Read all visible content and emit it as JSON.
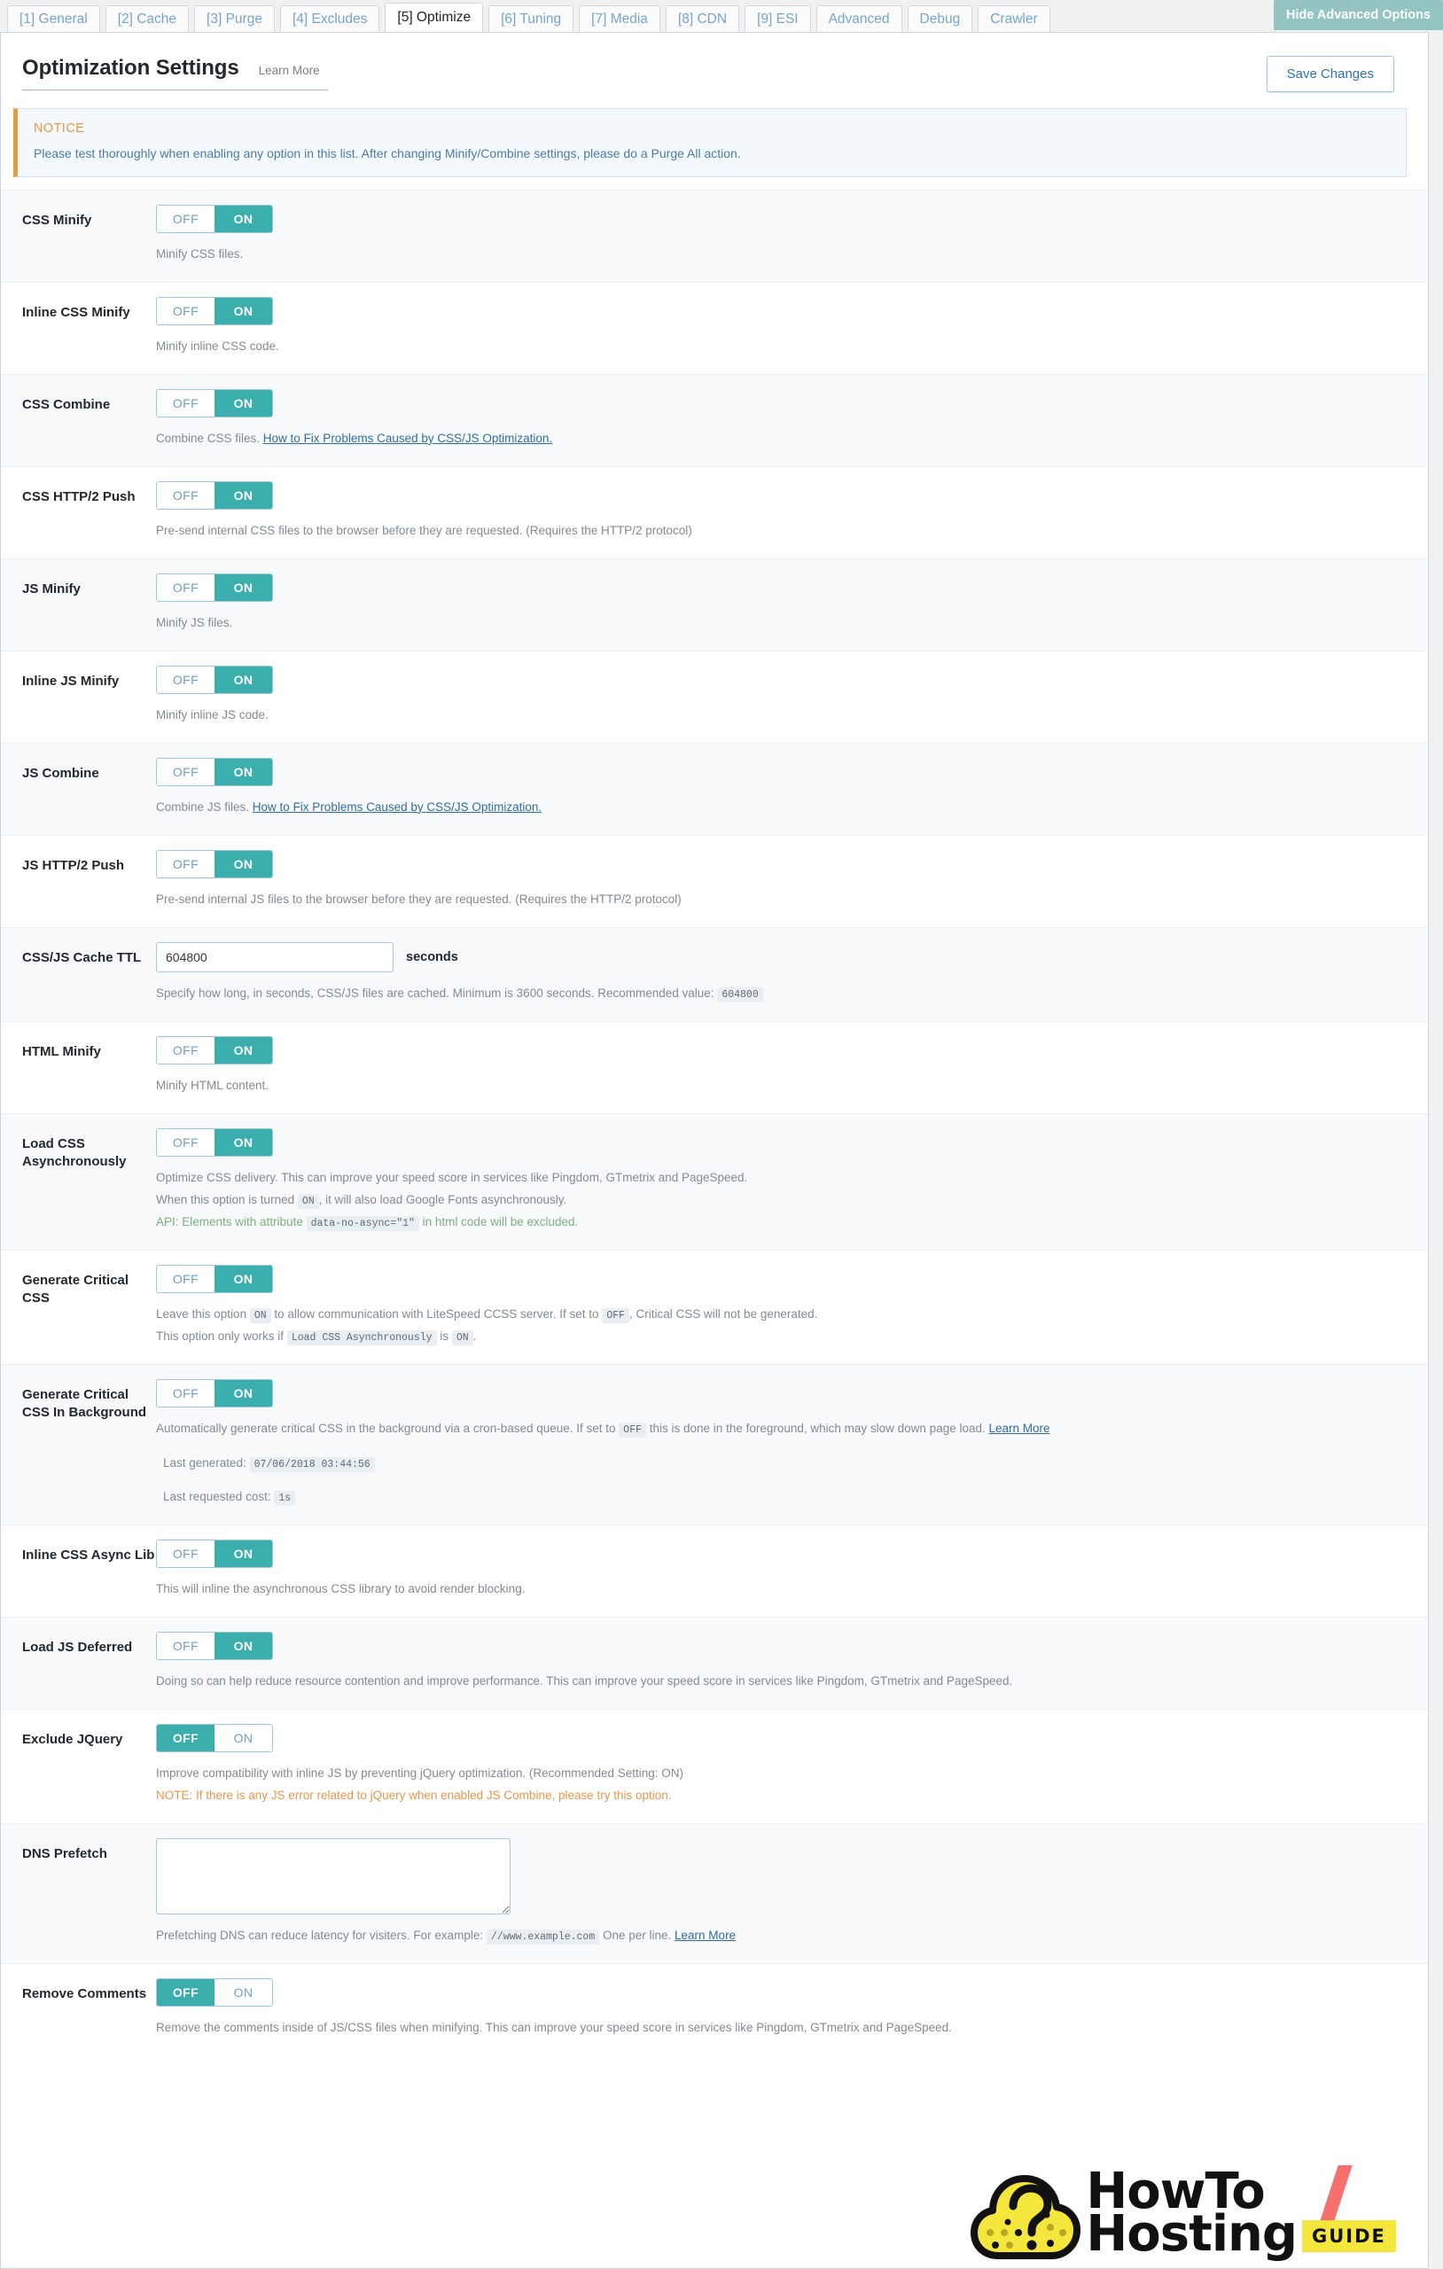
{
  "tabs": [
    {
      "label": "[1] General",
      "active": false
    },
    {
      "label": "[2] Cache",
      "active": false
    },
    {
      "label": "[3] Purge",
      "active": false
    },
    {
      "label": "[4] Excludes",
      "active": false
    },
    {
      "label": "[5] Optimize",
      "active": true
    },
    {
      "label": "[6] Tuning",
      "active": false
    },
    {
      "label": "[7] Media",
      "active": false
    },
    {
      "label": "[8] CDN",
      "active": false
    },
    {
      "label": "[9] ESI",
      "active": false
    },
    {
      "label": "Advanced",
      "active": false
    },
    {
      "label": "Debug",
      "active": false
    },
    {
      "label": "Crawler",
      "active": false
    }
  ],
  "header": {
    "hide_advanced_label": "Hide Advanced Options",
    "title": "Optimization Settings",
    "learn_more": "Learn More",
    "save_label": "Save Changes"
  },
  "notice": {
    "title": "NOTICE",
    "text": "Please test thoroughly when enabling any option in this list. After changing Minify/Combine settings, please do a Purge All action."
  },
  "toggle": {
    "off": "OFF",
    "on": "ON"
  },
  "units": {
    "seconds": "seconds"
  },
  "colors": {
    "accent_on": "#3aafad",
    "tab_text": "#75a5cc",
    "notice_bar": "#e89b3c",
    "link": "#2e6da4",
    "logo_yellow": "#f5e63c",
    "logo_red": "#f8706e"
  },
  "settings": [
    {
      "label": "CSS Minify",
      "value": "ON",
      "desc_plain": "Minify CSS files."
    },
    {
      "label": "Inline CSS Minify",
      "value": "ON",
      "desc_plain": "Minify inline CSS code."
    },
    {
      "label": "CSS Combine",
      "value": "ON",
      "desc_plain": "Combine CSS files.",
      "desc_link": "How to Fix Problems Caused by CSS/JS Optimization."
    },
    {
      "label": "CSS HTTP/2 Push",
      "value": "ON",
      "desc_plain": "Pre-send internal CSS files to the browser before they are requested. (Requires the HTTP/2 protocol)"
    },
    {
      "label": "JS Minify",
      "value": "ON",
      "desc_plain": "Minify JS files."
    },
    {
      "label": "Inline JS Minify",
      "value": "ON",
      "desc_plain": "Minify inline JS code."
    },
    {
      "label": "JS Combine",
      "value": "ON",
      "desc_plain": "Combine JS files.",
      "desc_link": "How to Fix Problems Caused by CSS/JS Optimization."
    },
    {
      "label": "JS HTTP/2 Push",
      "value": "ON",
      "desc_plain": "Pre-send internal JS files to the browser before they are requested. (Requires the HTTP/2 protocol)"
    },
    {
      "label": "CSS/JS Cache TTL",
      "input_value": "604800",
      "unit": "seconds",
      "desc_plain": "Specify how long, in seconds, CSS/JS files are cached. Minimum is 3600 seconds. Recommended value:",
      "desc_code": "604800"
    },
    {
      "label": "HTML Minify",
      "value": "ON",
      "desc_plain": "Minify HTML content."
    },
    {
      "label": "Load CSS Asynchronously",
      "value": "ON",
      "desc_line1": "Optimize CSS delivery. This can improve your speed score in services like Pingdom, GTmetrix and PageSpeed.",
      "desc_line2_a": "When this option is turned",
      "desc_line2_code": "ON",
      "desc_line2_b": ", it will also load Google Fonts asynchronously.",
      "desc_line3_a": "API: Elements with attribute",
      "desc_line3_code": "data-no-async=\"1\"",
      "desc_line3_b": "in html code will be excluded."
    },
    {
      "label": "Generate Critical CSS",
      "value": "ON",
      "desc_line1_a": "Leave this option",
      "desc_line1_code1": "ON",
      "desc_line1_b": "to allow communication with LiteSpeed CCSS server. If set to",
      "desc_line1_code2": "OFF",
      "desc_line1_c": ", Critical CSS will not be generated.",
      "desc_line2_a": "This option only works if",
      "desc_line2_code1": "Load CSS Asynchronously",
      "desc_line2_b": "is",
      "desc_line2_code2": "ON",
      "desc_line2_c": "."
    },
    {
      "label": "Generate Critical CSS In Background",
      "value": "ON",
      "desc_line1_a": "Automatically generate critical CSS in the background via a cron-based queue. If set to",
      "desc_line1_code": "OFF",
      "desc_line1_b": "this is done in the foreground, which may slow down page load.",
      "desc_link": "Learn More",
      "last_generated_label": "Last generated:",
      "last_generated_value": "07/06/2018 03:44:56",
      "last_cost_label": "Last requested cost:",
      "last_cost_value": "1s"
    },
    {
      "label": "Inline CSS Async Lib",
      "value": "ON",
      "desc_plain": "This will inline the asynchronous CSS library to avoid render blocking."
    },
    {
      "label": "Load JS Deferred",
      "value": "ON",
      "desc_plain": "Doing so can help reduce resource contention and improve performance. This can improve your speed score in services like Pingdom, GTmetrix and PageSpeed."
    },
    {
      "label": "Exclude JQuery",
      "value": "OFF",
      "desc_plain": "Improve compatibility with inline JS by preventing jQuery optimization. (Recommended Setting: ON)",
      "desc_note": "NOTE: If there is any JS error related to jQuery when enabled JS Combine, please try this option."
    },
    {
      "label": "DNS Prefetch",
      "textarea_value": "",
      "desc_plain": "Prefetching DNS can reduce latency for visiters. For example:",
      "desc_code": "//www.example.com",
      "desc_plain2": "One per line.",
      "desc_link": "Learn More"
    },
    {
      "label": "Remove Comments",
      "value": "OFF",
      "desc_plain": "Remove the comments inside of JS/CSS files when minifying. This can improve your speed score in services like Pingdom, GTmetrix and PageSpeed."
    }
  ],
  "logo": {
    "line1": "HowTo",
    "line2": "Hosting",
    "badge": "GUIDE"
  }
}
